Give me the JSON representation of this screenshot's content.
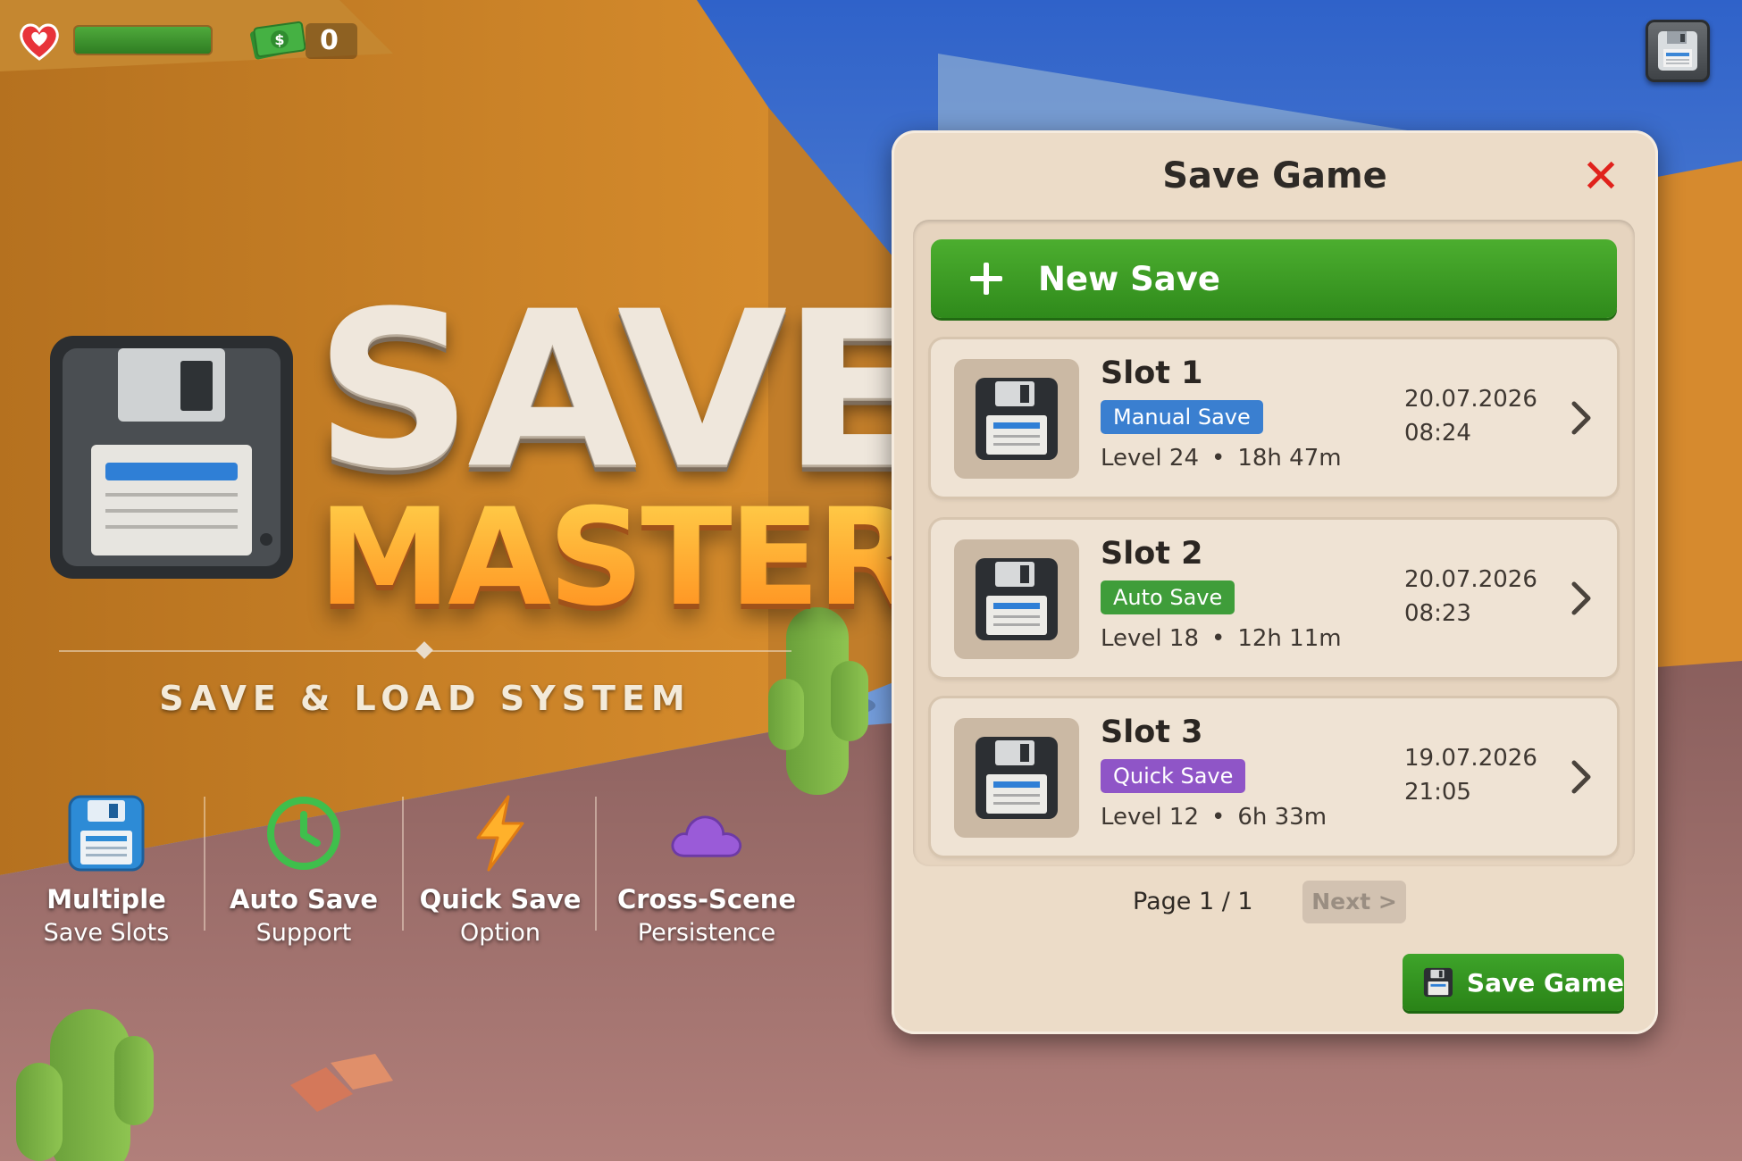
{
  "hud": {
    "health_fraction": 1.0,
    "money": "0",
    "icons": [
      "heart-icon",
      "money-icon",
      "floppy-disk-icon"
    ]
  },
  "logo": {
    "line1": "SAVE",
    "line2": "MASTER",
    "tagline": "SAVE & LOAD SYSTEM"
  },
  "features": [
    {
      "icon": "floppy-disk-icon",
      "line1": "Multiple",
      "line2": "Save Slots"
    },
    {
      "icon": "clock-icon",
      "line1": "Auto Save",
      "line2": "Support"
    },
    {
      "icon": "lightning-icon",
      "line1": "Quick Save",
      "line2": "Option"
    },
    {
      "icon": "cloud-icon",
      "line1": "Cross-Scene",
      "line2": "Persistence"
    }
  ],
  "panel": {
    "title": "Save Game",
    "close_label": "✕",
    "new_save_label": "New Save",
    "slots": [
      {
        "name": "Slot 1",
        "badge": "Manual Save",
        "badge_color": "#3a7fd0",
        "level": "Level 24",
        "playtime": "18h 47m",
        "date": "20.07.2026",
        "time": "08:24"
      },
      {
        "name": "Slot 2",
        "badge": "Auto Save",
        "badge_color": "#3f9d3a",
        "level": "Level 18",
        "playtime": "12h 11m",
        "date": "20.07.2026",
        "time": "08:23"
      },
      {
        "name": "Slot 3",
        "badge": "Quick Save",
        "badge_color": "#8f55c7",
        "level": "Level 12",
        "playtime": "6h 33m",
        "date": "19.07.2026",
        "time": "21:05"
      }
    ],
    "page_label": "Page 1 / 1",
    "next_label": "Next >",
    "save_button_label": "Save Game"
  },
  "colors": {
    "accent_green": "#3ea42a",
    "close_red": "#e0221c",
    "logo_orange": "#ffa52a",
    "panel_bg": "#ecdcc8"
  }
}
